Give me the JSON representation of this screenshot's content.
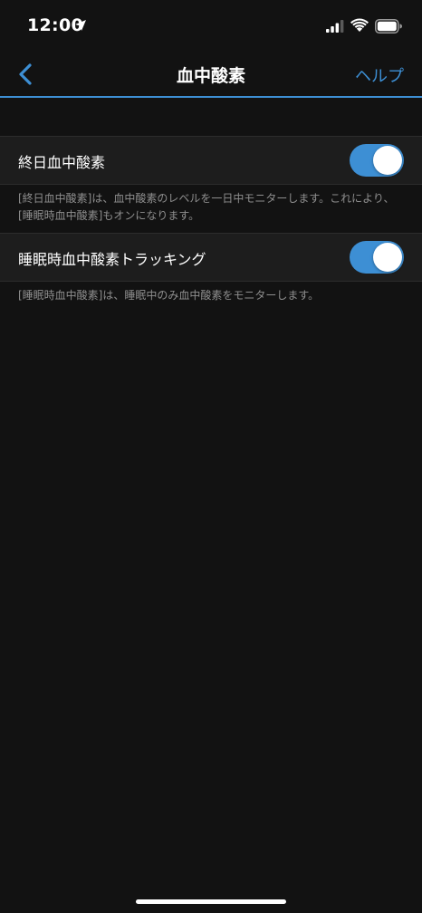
{
  "status_bar": {
    "time": "12:00",
    "icons": [
      "location-arrow-icon",
      "cellular-signal-icon",
      "wifi-icon",
      "battery-icon"
    ]
  },
  "nav": {
    "back_icon": "chevron-left-icon",
    "title": "血中酸素",
    "help_label": "ヘルプ"
  },
  "settings": [
    {
      "label": "終日血中酸素",
      "enabled": true,
      "description": "[終日血中酸素]は、血中酸素のレベルを一日中モニターします。これにより、[睡眠時血中酸素]もオンになります。"
    },
    {
      "label": "睡眠時血中酸素トラッキング",
      "enabled": true,
      "description": "[睡眠時血中酸素]は、睡眠中のみ血中酸素をモニターします。"
    }
  ],
  "colors": {
    "accent": "#3d8fd4",
    "background": "#121212",
    "row_background": "#1d1d1d",
    "description_text": "#8e8e8e"
  }
}
